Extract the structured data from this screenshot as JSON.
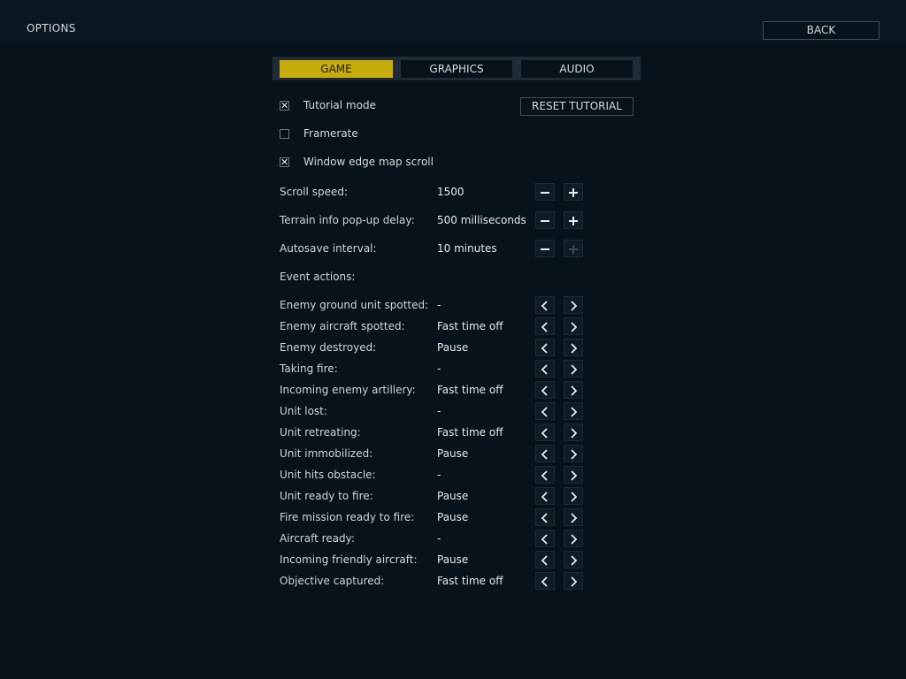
{
  "header": {
    "title": "OPTIONS",
    "back_label": "BACK"
  },
  "tabs": [
    {
      "label": "GAME",
      "active": true
    },
    {
      "label": "GRAPHICS",
      "active": false
    },
    {
      "label": "AUDIO",
      "active": false
    }
  ],
  "checkboxes": {
    "tutorial_mode": {
      "label": "Tutorial mode",
      "checked": true,
      "mark": "✕"
    },
    "framerate": {
      "label": "Framerate",
      "checked": false,
      "mark": ""
    },
    "edge_scroll": {
      "label": "Window edge map scroll",
      "checked": true,
      "mark": "✕"
    }
  },
  "reset_tutorial_label": "RESET TUTORIAL",
  "steppers": {
    "scroll_speed": {
      "label": "Scroll speed:",
      "value": "1500",
      "minus_enabled": true,
      "plus_enabled": true
    },
    "popup_delay": {
      "label": "Terrain info pop-up delay:",
      "value": "500 milliseconds",
      "minus_enabled": true,
      "plus_enabled": true
    },
    "autosave": {
      "label": "Autosave interval:",
      "value": "10 minutes",
      "minus_enabled": true,
      "plus_enabled": false
    }
  },
  "event_actions_heading": "Event actions:",
  "events": [
    {
      "label": "Enemy ground unit spotted:",
      "value": "-"
    },
    {
      "label": "Enemy aircraft spotted:",
      "value": "Fast time off"
    },
    {
      "label": "Enemy destroyed:",
      "value": "Pause"
    },
    {
      "label": "Taking fire:",
      "value": "-"
    },
    {
      "label": "Incoming enemy artillery:",
      "value": "Fast time off"
    },
    {
      "label": "Unit lost:",
      "value": "-"
    },
    {
      "label": "Unit retreating:",
      "value": "Fast time off"
    },
    {
      "label": "Unit immobilized:",
      "value": "Pause"
    },
    {
      "label": "Unit hits obstacle:",
      "value": "-"
    },
    {
      "label": "Unit ready to fire:",
      "value": "Pause"
    },
    {
      "label": "Fire mission ready to fire:",
      "value": "Pause"
    },
    {
      "label": "Aircraft ready:",
      "value": "-"
    },
    {
      "label": "Incoming friendly aircraft:",
      "value": "Pause"
    },
    {
      "label": "Objective captured:",
      "value": "Fast time off"
    }
  ],
  "icons": {
    "minus": "minus-icon",
    "plus": "plus-icon",
    "prev": "chevron-left-icon",
    "next": "chevron-right-icon"
  },
  "colors": {
    "background": "#07121a",
    "accent_tab": "#c7ad0c",
    "text": "#d6dbde"
  }
}
